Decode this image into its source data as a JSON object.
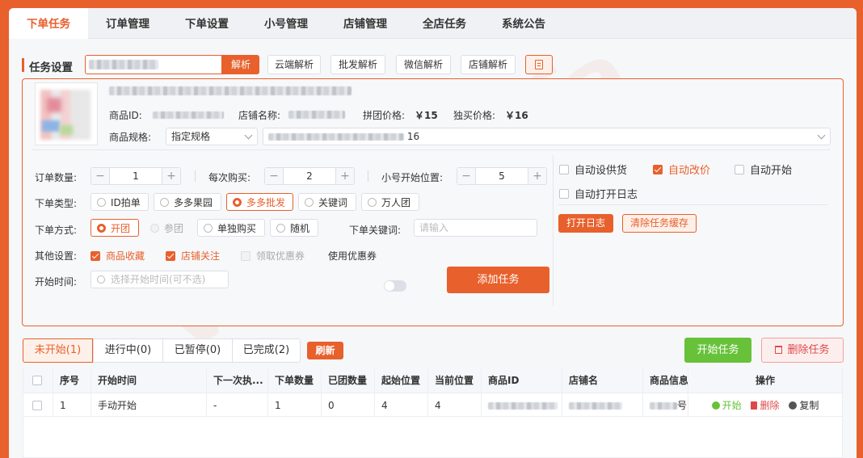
{
  "nav_tabs": [
    "下单任务",
    "订单管理",
    "下单设置",
    "小号管理",
    "店铺管理",
    "全店任务",
    "系统公告"
  ],
  "task_settings": {
    "title": "任务设置",
    "parse_btn": "解析",
    "quick_btns": [
      "云端解析",
      "批发解析",
      "微信解析",
      "店铺解析"
    ]
  },
  "product": {
    "id_label": "商品ID:",
    "shop_label": "店铺名称:",
    "group_price_label": "拼团价格:",
    "group_price": "￥15",
    "solo_price_label": "独买价格:",
    "solo_price": "￥16",
    "spec_label": "商品规格:",
    "spec_select": "指定规格",
    "spec_value_suffix": "16"
  },
  "form": {
    "order_qty_label": "订单数量:",
    "order_qty": "1",
    "per_buy_label": "每次购买:",
    "per_buy": "2",
    "start_pos_label": "小号开始位置:",
    "start_pos": "5",
    "order_type_label": "下单类型:",
    "order_types": [
      "ID拍单",
      "多多果园",
      "多多批发",
      "关键词",
      "万人团"
    ],
    "order_method_label": "下单方式:",
    "order_methods": [
      "开团",
      "参团",
      "单独购买",
      "随机"
    ],
    "keyword_label": "下单关键词:",
    "keyword_placeholder": "请输入",
    "other_label": "其他设置:",
    "other_opts": [
      "商品收藏",
      "店铺关注",
      "领取优惠券"
    ],
    "coupon_label": "使用优惠券",
    "start_time_label": "开始时间:",
    "start_time_placeholder": "选择开始时间(可不选)",
    "add_btn": "添加任务"
  },
  "right_opts": {
    "row1": [
      "自动设供货",
      "自动改价",
      "自动开始"
    ],
    "row2": "自动打开日志",
    "open_log_btn": "打开日志",
    "clear_btn": "清除任务缓存"
  },
  "status_tabs": [
    "未开始(1)",
    "进行中(0)",
    "已暂停(0)",
    "已完成(2)"
  ],
  "refresh_btn": "刷新",
  "start_task_btn": "开始任务",
  "delete_task_btn": "删除任务",
  "table": {
    "headers": [
      "序号",
      "开始时间",
      "下一次执...",
      "下单数量",
      "已团数量",
      "起始位置",
      "当前位置",
      "商品ID",
      "店铺名",
      "商品信息",
      "操作"
    ],
    "row": {
      "no": "1",
      "start_time": "手动开始",
      "next": "-",
      "qty": "1",
      "grouped": "0",
      "start": "4",
      "current": "4",
      "info_tail": "号"
    },
    "actions": [
      "开始",
      "删除",
      "复制"
    ]
  },
  "watermark": "V: zuxjdifa",
  "colors": {
    "accent": "#e8602c",
    "green": "#67c23a",
    "red": "#e04848"
  }
}
